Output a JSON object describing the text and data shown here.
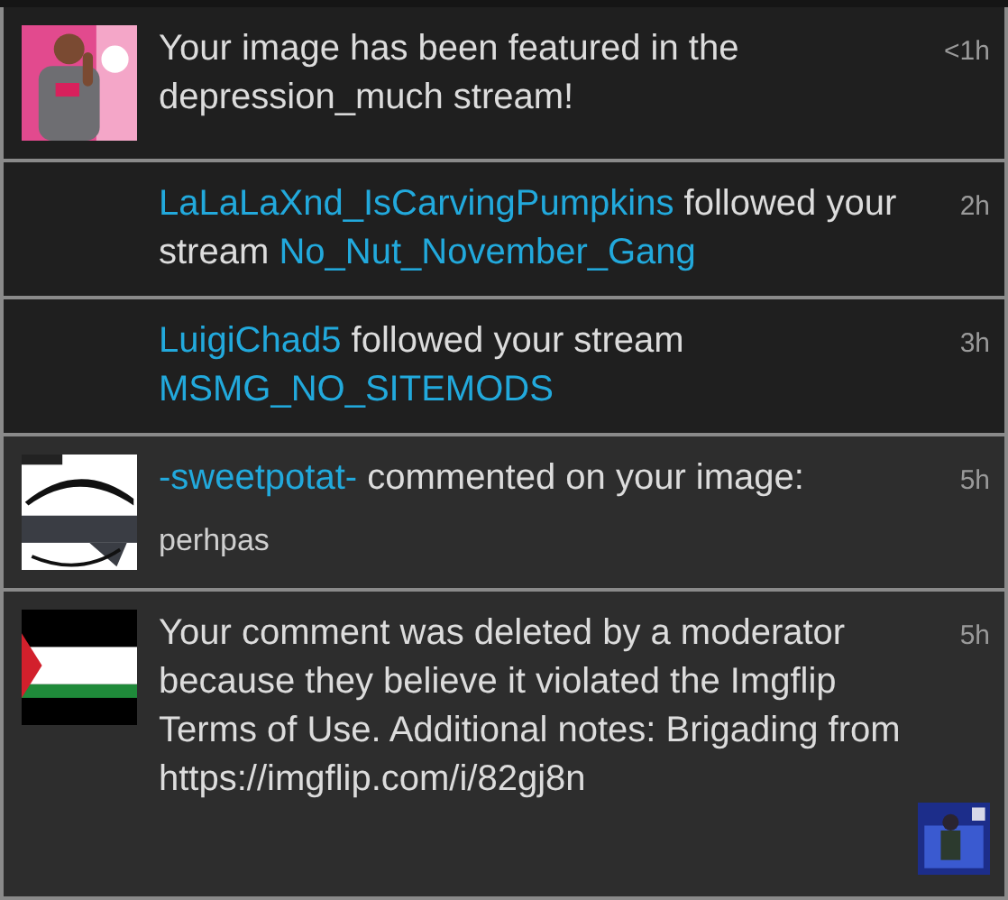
{
  "notifications": [
    {
      "unread": true,
      "thumbnail": {
        "kind": "picture"
      },
      "parts": [
        {
          "text": "Your image has been featured in the depression_much stream!",
          "link": false
        }
      ],
      "time": "<1h"
    },
    {
      "unread": true,
      "parts": [
        {
          "text": "LaLaLaXnd_IsCarvingPumpkins",
          "link": true
        },
        {
          "text": " followed your stream ",
          "link": false
        },
        {
          "text": "No_Nut_November_Gang",
          "link": true
        }
      ],
      "time": "2h"
    },
    {
      "unread": true,
      "parts": [
        {
          "text": "LuigiChad5",
          "link": true
        },
        {
          "text": " followed your stream ",
          "link": false
        },
        {
          "text": "MSMG_NO_SITEMODS",
          "link": true
        }
      ],
      "time": "3h"
    },
    {
      "unread": false,
      "thumbnail": {
        "kind": "picture"
      },
      "parts": [
        {
          "text": "-sweetpotat-",
          "link": true
        },
        {
          "text": " commented on your image:",
          "link": false
        }
      ],
      "comment": "perhpas",
      "time": "5h"
    },
    {
      "unread": false,
      "thumbnail": {
        "kind": "picture"
      },
      "parts": [
        {
          "text": "Your comment was deleted by a moderator because they believe it violated the Imgflip Terms of Use. Additional notes: Brigading from https://imgflip.com/i/82gj8n",
          "link": false
        }
      ],
      "time": "5h",
      "side_picture": {
        "kind": "picture"
      }
    }
  ]
}
